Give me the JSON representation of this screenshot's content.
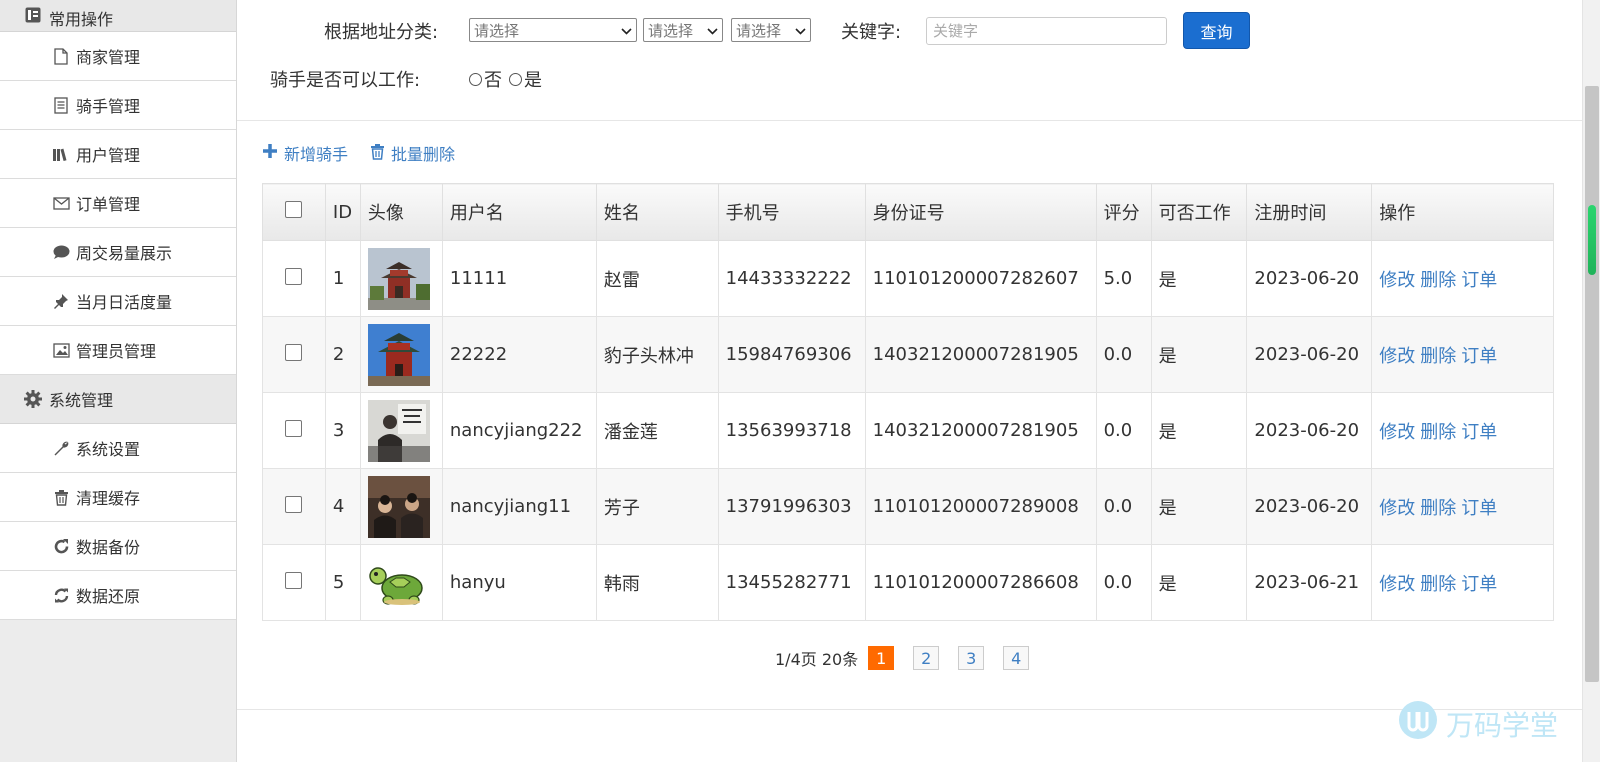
{
  "sidebar": {
    "groups": [
      {
        "label": "常用操作",
        "icon": "list-icon"
      },
      {
        "label": "系统管理",
        "icon": "gear-icon"
      }
    ],
    "items_common": [
      {
        "label": "商家管理",
        "icon": "file-icon"
      },
      {
        "label": "骑手管理",
        "icon": "document-icon"
      },
      {
        "label": "用户管理",
        "icon": "books-icon"
      },
      {
        "label": "订单管理",
        "icon": "envelope-icon"
      },
      {
        "label": "周交易量展示",
        "icon": "comment-icon"
      },
      {
        "label": "当月日活度量",
        "icon": "pushpin-icon"
      },
      {
        "label": "管理员管理",
        "icon": "picture-icon"
      }
    ],
    "items_system": [
      {
        "label": "系统设置",
        "icon": "wrench-icon"
      },
      {
        "label": "清理缓存",
        "icon": "trash-icon"
      },
      {
        "label": "数据备份",
        "icon": "repeat-icon"
      },
      {
        "label": "数据还原",
        "icon": "refresh-icon"
      }
    ]
  },
  "filters": {
    "address_label": "根据地址分类:",
    "select1": "请选择",
    "select2": "请选择",
    "select3": "请选择",
    "keyword_label": "关键字:",
    "keyword_placeholder": "关键字",
    "query_button": "查询",
    "work_label": "骑手是否可以工作:",
    "radio_no": "否",
    "radio_yes": "是"
  },
  "actions": {
    "add": "新增骑手",
    "batch_delete": "批量删除"
  },
  "table": {
    "headers": [
      "ID",
      "头像",
      "用户名",
      "姓名",
      "手机号",
      "身份证号",
      "评分",
      "可否工作",
      "注册时间",
      "操作"
    ],
    "rows": [
      {
        "id": "1",
        "username": "11111",
        "name": "赵雷",
        "phone": "14433332222",
        "idcard": "110101200007282607",
        "score": "5.0",
        "work": "是",
        "date": "2023-06-20",
        "avatar": "tower"
      },
      {
        "id": "2",
        "username": "22222",
        "name": "豹子头林冲",
        "phone": "15984769306",
        "idcard": "140321200007281905",
        "score": "0.0",
        "work": "是",
        "date": "2023-06-20",
        "avatar": "tower"
      },
      {
        "id": "3",
        "username": "nancyjiang222",
        "name": "潘金莲",
        "phone": "13563993718",
        "idcard": "140321200007281905",
        "score": "0.0",
        "work": "是",
        "date": "2023-06-20",
        "avatar": "person"
      },
      {
        "id": "4",
        "username": "nancyjiang11",
        "name": "芳子",
        "phone": "13791996303",
        "idcard": "110101200007289008",
        "score": "0.0",
        "work": "是",
        "date": "2023-06-20",
        "avatar": "people"
      },
      {
        "id": "5",
        "username": "hanyu",
        "name": "韩雨",
        "phone": "13455282771",
        "idcard": "110101200007286608",
        "score": "0.0",
        "work": "是",
        "date": "2023-06-21",
        "avatar": "turtle"
      }
    ],
    "ops": [
      "修改",
      "删除",
      "订单"
    ]
  },
  "pager": {
    "summary": "1/4页 20条",
    "pages": [
      "1",
      "2",
      "3",
      "4"
    ],
    "current": "1"
  },
  "watermark": "万码学堂",
  "colors": {
    "link": "#3f7fc3",
    "primary": "#1b6ed0",
    "current_page": "#ff6a00"
  }
}
